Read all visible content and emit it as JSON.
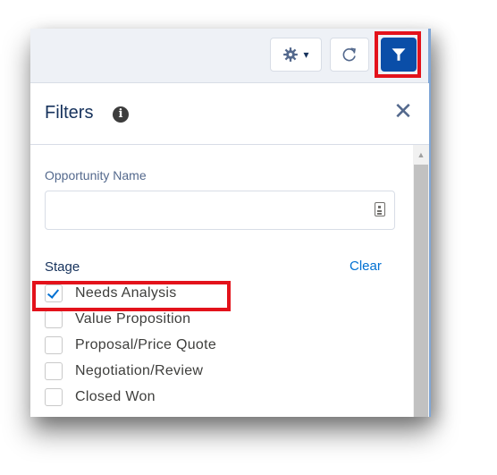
{
  "toolbar": {
    "gear_icon": "gear-icon",
    "dropdown_caret": "▾",
    "refresh_icon": "refresh-icon",
    "filter_icon": "filter-icon",
    "highlight_color": "#e3121b",
    "filter_button_color": "#0a4ea8"
  },
  "panel": {
    "title": "Filters",
    "info_glyph": "i",
    "close_glyph": "✕"
  },
  "opportunity_name": {
    "label": "Opportunity Name",
    "value": "",
    "placeholder": ""
  },
  "stage": {
    "label": "Stage",
    "clear_label": "Clear",
    "options": [
      {
        "label": "Needs Analysis",
        "checked": true
      },
      {
        "label": "Value Proposition",
        "checked": false
      },
      {
        "label": "Proposal/Price Quote",
        "checked": false
      },
      {
        "label": "Negotiation/Review",
        "checked": false
      },
      {
        "label": "Closed Won",
        "checked": false
      }
    ]
  }
}
